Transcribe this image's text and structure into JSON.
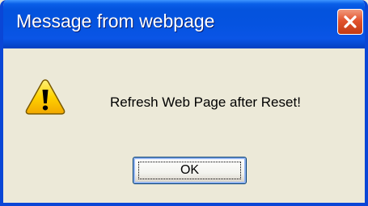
{
  "dialog": {
    "title": "Message from webpage",
    "message": "Refresh Web Page after Reset!",
    "ok_label": "OK",
    "icon": "warning-icon",
    "close_icon": "close-icon"
  },
  "colors": {
    "titlebar": "#0553e0",
    "window_border": "#0a46d6",
    "body_background": "#ece9d8",
    "close_button": "#e2532d",
    "warning_fill": "#ffd200"
  }
}
